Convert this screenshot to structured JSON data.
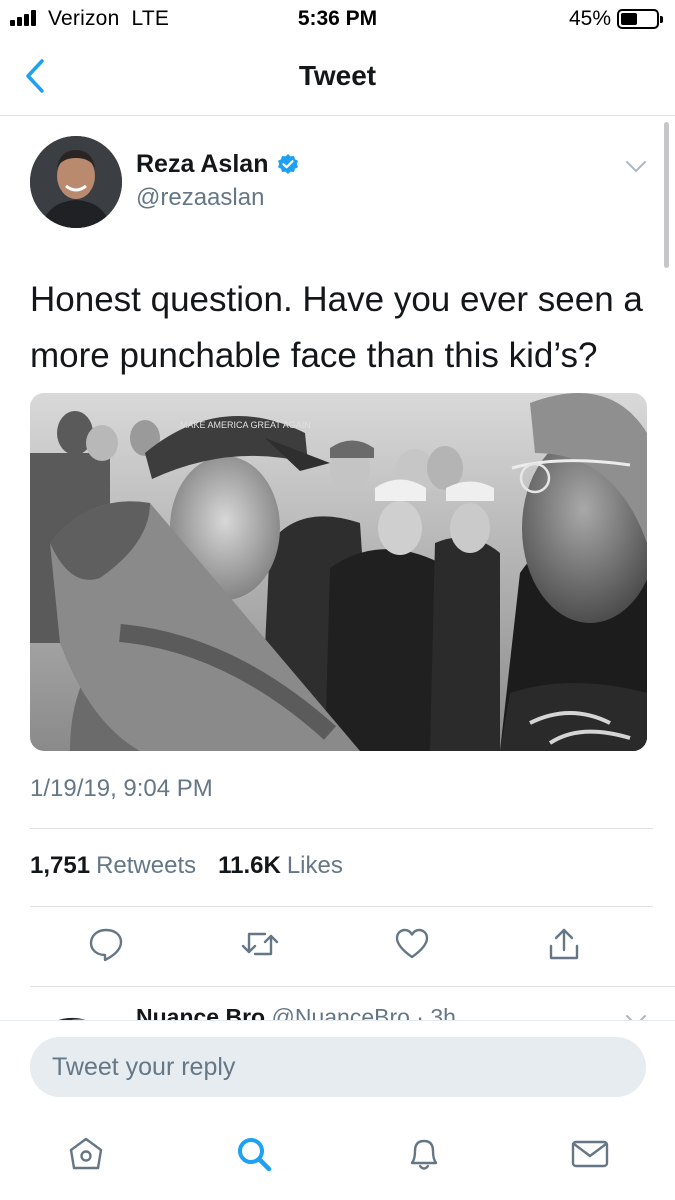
{
  "status_bar": {
    "carrier": "Verizon",
    "network": "LTE",
    "time": "5:36 PM",
    "battery": "45%",
    "battery_level": 0.45
  },
  "nav": {
    "title": "Tweet",
    "back_icon": "chevron-left-icon"
  },
  "tweet": {
    "author_name": "Reza Aslan",
    "verified": true,
    "handle": "@rezaaslan",
    "text": "Honest question. Have you ever seen a more punchable face than this kid’s?",
    "timestamp": "1/19/19, 9:04 PM",
    "retweets_count": "1,751",
    "retweets_label": "Retweets",
    "likes_count": "11.6K",
    "likes_label": "Likes",
    "photo_caption_text": "MAKE AMERICA GREAT AGAIN"
  },
  "actions": [
    "reply-icon",
    "retweet-icon",
    "like-icon",
    "share-icon"
  ],
  "reply_preview": {
    "name": "Nuance Bro",
    "meta": "@NuanceBro · 3h"
  },
  "composer": {
    "placeholder": "Tweet your reply"
  },
  "tabbar": [
    "home-icon",
    "search-icon",
    "notifications-icon",
    "messages-icon"
  ],
  "colors": {
    "accent": "#1da1f2",
    "secondary_text": "#657786",
    "divider": "#dfe3e8",
    "input_bg": "#e6ecf0"
  }
}
